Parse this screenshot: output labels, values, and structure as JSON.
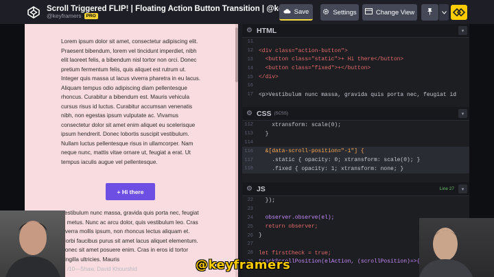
{
  "header": {
    "pen_title": "Scroll Triggered FLIP! | Floating Action Button Transition | @keyframers ...",
    "username": "@keyframers",
    "pro_badge": "PRO",
    "save_label": "Save",
    "settings_label": "Settings",
    "change_view_label": "Change View"
  },
  "preview": {
    "paragraph1": "Lorem ipsum dolor sit amet, consectetur adipiscing elit. Praesent bibendum, lorem vel tincidunt imperdiet, nibh elit laoreet felis, a bibendum nisl tortor non orci. Donec pretium fermentum felis, quis aliquet est rutrum ut. Integer quis massa ut lacus viverra pharetra in eu lacus. Aliquam tempus odio adipiscing diam pellentesque rhoncus. Curabitur a bibendum est. Mauris vehicula cursus risus id luctus. Curabitur accumsan venenatis nibh, non egestas ipsum vulputate ac. Vivamus consectetur dolor sit amet enim aliquet eu scelerisque ipsum hendrerit. Donec lobortis suscipit vestibulum. Nullam luctus pellentesque risus in ullamcorper. Nam neque nunc, mattis vitae ornare ut, feugiat a erat. Ut tempus iaculis augue vel pellentesque.",
    "button_label": "+ Hi there",
    "paragraph2": "Vestibulum nunc massa, gravida quis porta nec, feugiat id metus. Nunc ac arcu dolor, quis vestibulum leo. Cras viverra mollis ipsum, non rhoncus lectus aliquam et. Morbi faucibus purus sit amet lacus aliquet elementum. Donec sit amet posuere enim. Cras in eros id tortor fringilla ultricies. Mauris"
  },
  "editors": {
    "html": {
      "title": "HTML",
      "lines": [
        {
          "n": "11",
          "text": ""
        },
        {
          "n": "12",
          "text": "<div class=\"action-button\">"
        },
        {
          "n": "13",
          "text": "  <button class=\"static\">+ Hi there</button>"
        },
        {
          "n": "14",
          "text": "  <button class=\"fixed\">+</button>"
        },
        {
          "n": "15",
          "text": "</div>"
        },
        {
          "n": "16",
          "text": ""
        },
        {
          "n": "17",
          "text": "<p>Vestibulum nunc massa, gravida quis porta nec, feugiat id"
        }
      ]
    },
    "css": {
      "title": "CSS",
      "sub": "(SCSS)",
      "lines": [
        {
          "n": "112",
          "text": "    xtransform: scale(0);"
        },
        {
          "n": "113",
          "text": "  }"
        },
        {
          "n": "114",
          "text": ""
        },
        {
          "n": "116",
          "text": "  &[data-scroll-position=\"-1\"] {"
        },
        {
          "n": "117",
          "text": "    .static { opacity: 0; xtransform: scale(0); }"
        },
        {
          "n": "118",
          "text": "    .fixed { opacity: 1; xtransform: none; }"
        }
      ]
    },
    "js": {
      "title": "JS",
      "line_indicator": "Line 27",
      "lines": [
        {
          "n": "22",
          "text": "  });"
        },
        {
          "n": "23",
          "text": ""
        },
        {
          "n": "24",
          "text": "  observer.observe(el);"
        },
        {
          "n": "25",
          "text": "  return observer;"
        },
        {
          "n": "26",
          "text": "}"
        },
        {
          "n": "27",
          "text": ""
        },
        {
          "n": "28",
          "text": "let firstCheck = true;"
        },
        {
          "n": "29",
          "text": "trackScrollPosition(elAction, (scrollPosition)=>{"
        }
      ]
    }
  },
  "stream": {
    "caption": "/10—Shaw, David Khourshid",
    "watermark": "@keyframers"
  },
  "colors": {
    "accent_yellow": "#ffdd40",
    "button_purple": "#6e4fe4",
    "preview_bg": "#f8dcdf",
    "editor_bg": "#1d1e22"
  }
}
